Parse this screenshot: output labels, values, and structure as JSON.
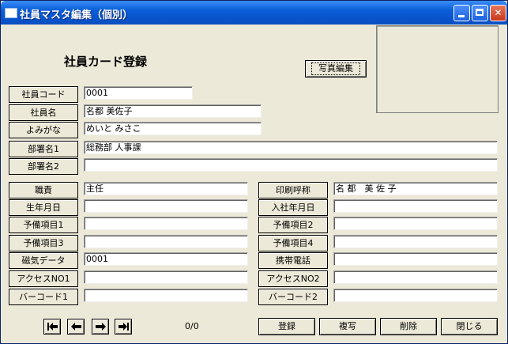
{
  "window": {
    "title": "社員マスタ編集（個別）"
  },
  "heading": "社員カード登録",
  "photo_button": "写真編集",
  "fields": [
    {
      "id": "emp-code",
      "label": "社員コード",
      "value": "0001"
    },
    {
      "id": "emp-name",
      "label": "社員名",
      "value": "名都 美佐子"
    },
    {
      "id": "emp-kana",
      "label": "よみがな",
      "value": "めいと みさこ"
    },
    {
      "id": "dept1",
      "label": "部署名1",
      "value": "総務部 人事課"
    },
    {
      "id": "dept2",
      "label": "部署名2",
      "value": ""
    },
    {
      "id": "position",
      "label": "職責",
      "value": "主任"
    },
    {
      "id": "birth",
      "label": "生年月日",
      "value": ""
    },
    {
      "id": "spare1",
      "label": "予備項目1",
      "value": ""
    },
    {
      "id": "spare3",
      "label": "予備項目3",
      "value": ""
    },
    {
      "id": "magnetic",
      "label": "磁気データ",
      "value": "0001"
    },
    {
      "id": "access1",
      "label": "アクセスNO1",
      "value": ""
    },
    {
      "id": "barcode1",
      "label": "バーコード1",
      "value": ""
    },
    {
      "id": "print-name",
      "label": "印刷呼称",
      "value": "名 都　美 佐 子"
    },
    {
      "id": "join-date",
      "label": "入社年月日",
      "value": ""
    },
    {
      "id": "spare2",
      "label": "予備項目2",
      "value": ""
    },
    {
      "id": "spare4",
      "label": "予備項目4",
      "value": ""
    },
    {
      "id": "mobile",
      "label": "携帯電話",
      "value": ""
    },
    {
      "id": "access2",
      "label": "アクセスNO2",
      "value": ""
    },
    {
      "id": "barcode2",
      "label": "バーコード2",
      "value": ""
    }
  ],
  "record_counter": "0/0",
  "buttons": {
    "register": "登録",
    "copy": "複写",
    "delete": "削除",
    "close": "閉じる"
  },
  "icons": {
    "first": "first-record-icon",
    "prev": "prev-record-icon",
    "next": "next-record-icon",
    "last": "last-record-icon"
  }
}
